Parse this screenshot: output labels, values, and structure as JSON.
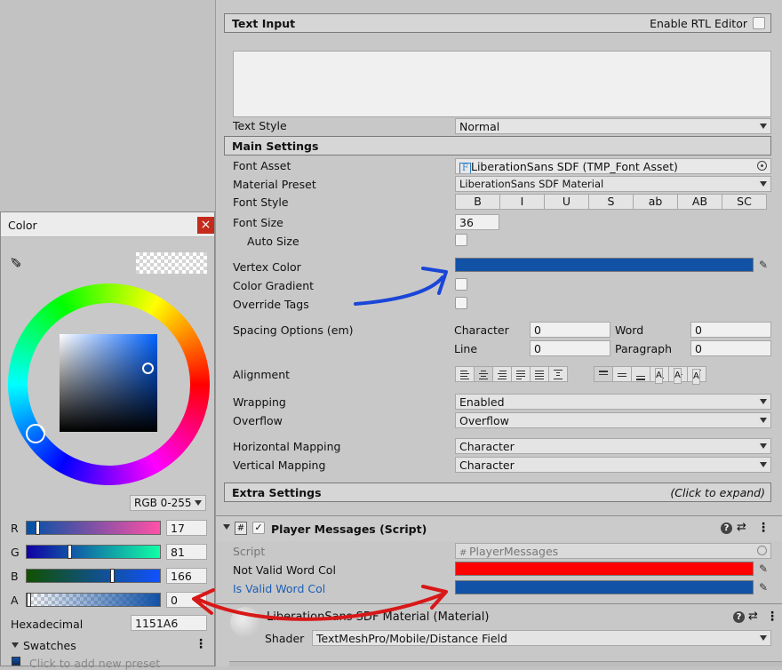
{
  "inspector": {
    "text_input": {
      "title": "Text Input",
      "rtl_label": "Enable RTL Editor"
    },
    "text_style": {
      "label": "Text Style",
      "value": "Normal"
    },
    "main_settings": {
      "title": "Main Settings",
      "font_asset_label": "Font Asset",
      "font_asset_value": "LiberationSans SDF (TMP_Font Asset)",
      "font_asset_icon": "F",
      "material_preset_label": "Material Preset",
      "material_preset_value": "LiberationSans SDF Material",
      "font_style_label": "Font Style",
      "font_style_buttons": [
        "B",
        "I",
        "U",
        "S",
        "ab",
        "AB",
        "SC"
      ],
      "font_size_label": "Font Size",
      "font_size_value": "36",
      "auto_size_label": "Auto Size",
      "vertex_color_label": "Vertex Color",
      "vertex_color": "#1151A6",
      "color_gradient_label": "Color Gradient",
      "override_tags_label": "Override Tags",
      "spacing_label": "Spacing Options (em)",
      "character_label": "Character",
      "character_value": "0",
      "word_label": "Word",
      "word_value": "0",
      "line_label": "Line",
      "line_value": "0",
      "paragraph_label": "Paragraph",
      "paragraph_value": "0",
      "alignment_label": "Alignment",
      "wrapping_label": "Wrapping",
      "wrapping_value": "Enabled",
      "overflow_label": "Overflow",
      "overflow_value": "Overflow",
      "hmapping_label": "Horizontal Mapping",
      "hmapping_value": "Character",
      "vmapping_label": "Vertical Mapping",
      "vmapping_value": "Character"
    },
    "extra_settings": {
      "title": "Extra Settings",
      "hint": "(Click to expand)"
    },
    "player_messages": {
      "hash_icon": "#",
      "check_icon": "✓",
      "title": "Player Messages (Script)",
      "script_label": "Script",
      "script_value": "PlayerMessages",
      "not_valid_label": "Not Valid Word Col",
      "not_valid_color": "#FF0000",
      "is_valid_label": "Is Valid Word Col",
      "is_valid_color": "#1151A6"
    },
    "material": {
      "title": "LiberationSans SDF Material (Material)",
      "shader_label": "Shader",
      "shader_value": "TextMeshPro/Mobile/Distance Field"
    },
    "component_icons": {
      "help": "?",
      "settings": "⇄",
      "more": "⋮"
    }
  },
  "color_window": {
    "title": "Color",
    "close_icon": "×",
    "eyedropper_icon": "✎",
    "mode_value": "RGB 0-255",
    "r_label": "R",
    "r_value": "17",
    "r_fraction": 0.067,
    "g_label": "G",
    "g_value": "81",
    "g_fraction": 0.318,
    "b_label": "B",
    "b_value": "166",
    "b_fraction": 0.651,
    "a_label": "A",
    "a_value": "0",
    "a_fraction": 0.0,
    "hex_label": "Hexadecimal",
    "hex_value": "1151A6",
    "swatches_label": "Swatches",
    "preset_text": "Click to add new preset",
    "more_icon": "⋮"
  },
  "colors": {
    "vertex": "#1151A6",
    "red": "#FF0000",
    "annotation_blue": "#1a46d8",
    "annotation_red": "#d81818"
  }
}
